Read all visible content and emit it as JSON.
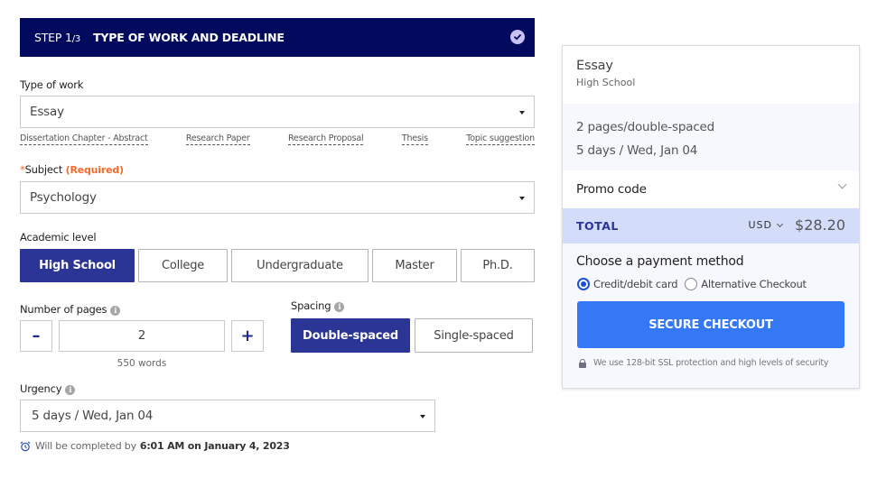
{
  "step": {
    "number": "STEP 1",
    "of": "/3",
    "title": "TYPE OF WORK AND DEADLINE",
    "status_icon": "check-circle-icon"
  },
  "type_of_work": {
    "label": "Type of work",
    "value": "Essay",
    "quick_links": [
      "Dissertation Chapter - Abstract",
      "Research Paper",
      "Research Proposal",
      "Thesis",
      "Topic suggestion"
    ]
  },
  "subject": {
    "star": "*",
    "label": "Subject",
    "required": "(Required)",
    "value": "Psychology"
  },
  "academic_level": {
    "label": "Academic level",
    "options": [
      "High School",
      "College",
      "Undergraduate",
      "Master",
      "Ph.D."
    ],
    "selected": "High School"
  },
  "pages": {
    "label": "Number of pages",
    "minus": "–",
    "plus": "+",
    "value": "2",
    "words": "550 words"
  },
  "spacing": {
    "label": "Spacing",
    "options": [
      "Double-spaced",
      "Single-spaced"
    ],
    "selected": "Double-spaced"
  },
  "urgency": {
    "label": "Urgency",
    "value": "5 days / Wed, Jan 04",
    "note_prefix": "Will be completed by",
    "note_time": "6:01 AM on January 4, 2023"
  },
  "summary": {
    "title": "Essay",
    "level": "High School",
    "pages_line": "2 pages/double-spaced",
    "deadline_line": "5 days / Wed, Jan 04",
    "promo_label": "Promo code",
    "total_label": "TOTAL",
    "currency": "USD",
    "price": "$28.20",
    "payment_title": "Choose a payment method",
    "payment_options": [
      "Credit/debit card",
      "Alternative Checkout"
    ],
    "payment_selected": "Credit/debit card",
    "checkout_label": "SECURE CHECKOUT",
    "ssl_note": "We use 128-bit SSL protection and high levels of security"
  },
  "colors": {
    "header_bg": "#020a5e",
    "active_btn": "#2b3595",
    "required": "#f26a2a",
    "checkout": "#3478f6",
    "total_bg": "#d3ddfa"
  }
}
